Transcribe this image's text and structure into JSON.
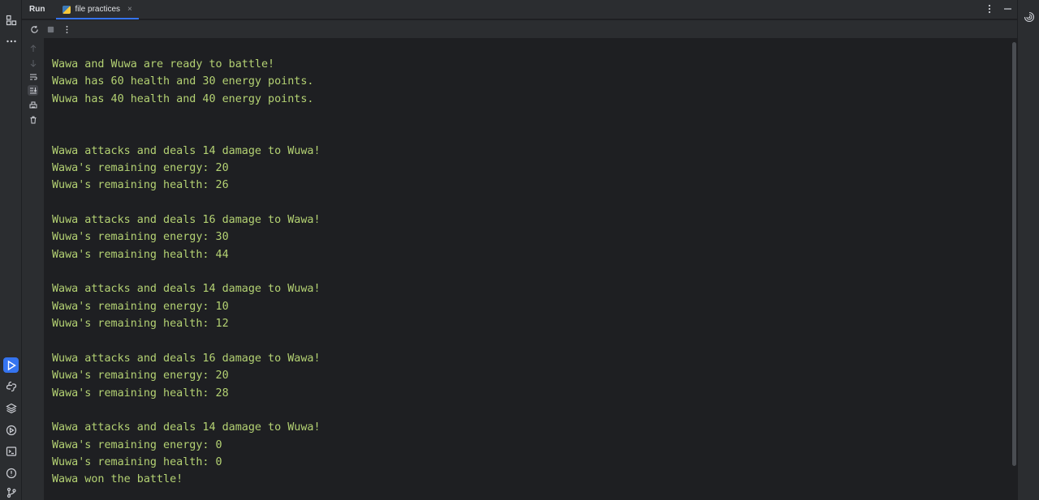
{
  "header": {
    "title": "Run",
    "tab_label": "file practices",
    "tab_close": "×"
  },
  "left_strip": {
    "top_icons": [
      "project-icon",
      "more-icon"
    ],
    "bottom_icons": [
      "run-icon",
      "python-console-icon",
      "packages-icon",
      "services-icon",
      "terminal-icon",
      "problems-icon",
      "git-icon"
    ]
  },
  "right_strip": {
    "icons": [
      "ai-assistant-icon"
    ]
  },
  "toolbar": {
    "icons": [
      "rerun-icon",
      "stop-icon",
      "more-options-icon"
    ]
  },
  "gutter": {
    "icons": [
      "scroll-up-icon",
      "scroll-down-icon",
      "soft-wrap-icon",
      "scroll-to-end-icon",
      "print-icon",
      "clear-icon"
    ]
  },
  "console": {
    "lines": [
      "Wawa and Wuwa are ready to battle!",
      "Wawa has 60 health and 30 energy points.",
      "Wuwa has 40 health and 40 energy points.",
      "",
      "",
      "Wawa attacks and deals 14 damage to Wuwa!",
      "Wawa's remaining energy: 20",
      "Wuwa's remaining health: 26",
      "",
      "Wuwa attacks and deals 16 damage to Wawa!",
      "Wuwa's remaining energy: 30",
      "Wawa's remaining health: 44",
      "",
      "Wawa attacks and deals 14 damage to Wuwa!",
      "Wawa's remaining energy: 10",
      "Wuwa's remaining health: 12",
      "",
      "Wuwa attacks and deals 16 damage to Wawa!",
      "Wuwa's remaining energy: 20",
      "Wawa's remaining health: 28",
      "",
      "Wawa attacks and deals 14 damage to Wuwa!",
      "Wawa's remaining energy: 0",
      "Wuwa's remaining health: 0",
      "Wawa won the battle!"
    ]
  },
  "colors": {
    "output_text": "#b4d273",
    "accent": "#3574f0",
    "background": "#1e1f22",
    "panel": "#2b2d30"
  }
}
